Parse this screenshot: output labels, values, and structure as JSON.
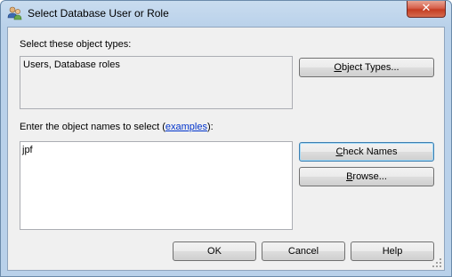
{
  "window": {
    "title": "Select Database User or Role",
    "close_glyph": "✕"
  },
  "object_types": {
    "label": "Select these object types:",
    "value": "Users, Database roles",
    "button": {
      "accel": "O",
      "rest": "bject Types..."
    }
  },
  "object_names": {
    "label_prefix": "Enter the object names to select (",
    "link": "examples",
    "label_suffix": "):",
    "value": "jpf"
  },
  "buttons": {
    "check_names": {
      "accel": "C",
      "rest": "heck Names"
    },
    "browse": {
      "accel": "B",
      "rest": "rowse..."
    },
    "ok": "OK",
    "cancel": "Cancel",
    "help": "Help"
  },
  "icons": {
    "title": "users-icon",
    "close": "close-icon",
    "grip": "resize-grip-icon"
  },
  "colors": {
    "link": "#0033cc",
    "default_border": "#3c7fb1",
    "close_red": "#c43d22"
  }
}
